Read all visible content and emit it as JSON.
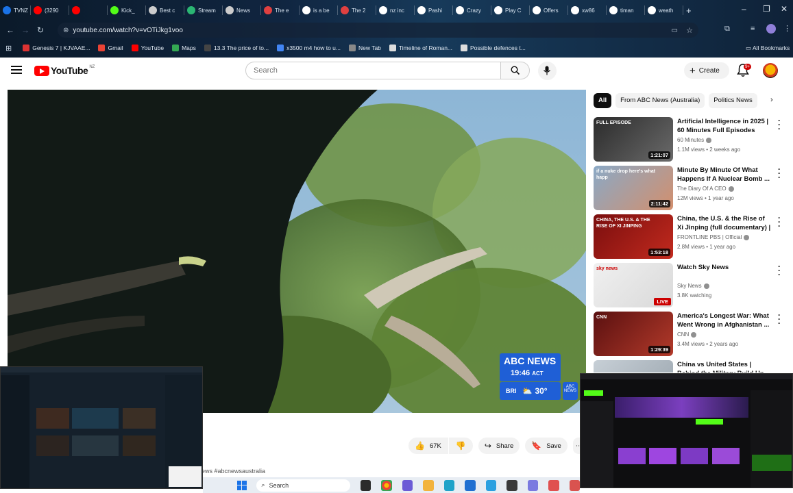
{
  "browser": {
    "tabs": [
      {
        "label": "TVNZ",
        "color": "#1a73e8"
      },
      {
        "label": "(3290",
        "color": "#ff0000"
      },
      {
        "label": "",
        "color": "#ff0000"
      },
      {
        "label": "Kick_",
        "color": "#53fc18"
      },
      {
        "label": "Best c",
        "color": "#cccccc"
      },
      {
        "label": "Stream",
        "color": "#2bb673"
      },
      {
        "label": "News",
        "color": "#cccccc"
      },
      {
        "label": "The e",
        "color": "#e04040"
      },
      {
        "label": "is a be",
        "color": "#ffffff"
      },
      {
        "label": "The 2",
        "color": "#e04040"
      },
      {
        "label": "nz inc",
        "color": "#ffffff"
      },
      {
        "label": "Pashi",
        "color": "#ffffff"
      },
      {
        "label": "Crazy",
        "color": "#ffffff"
      },
      {
        "label": "Play C",
        "color": "#ffffff"
      },
      {
        "label": "Offers",
        "color": "#ffffff"
      },
      {
        "label": "xw86",
        "color": "#ffffff"
      },
      {
        "label": "timan",
        "color": "#ffffff"
      },
      {
        "label": "weath",
        "color": "#ffffff"
      }
    ],
    "new_tab": "+",
    "window_controls": {
      "minimize": "–",
      "maximize": "❐",
      "close": "✕"
    },
    "url": "youtube.com/watch?v=vOTiJkg1voo",
    "bookmarks": [
      {
        "label": "Genesis 7 | KJVAAE...",
        "color": "#d33"
      },
      {
        "label": "Gmail",
        "color": "#ea4335"
      },
      {
        "label": "YouTube",
        "color": "#ff0000"
      },
      {
        "label": "Maps",
        "color": "#34a853"
      },
      {
        "label": "13.3 The price of to...",
        "color": "#444"
      },
      {
        "label": "x3500 m4 how to u...",
        "color": "#4285f4"
      },
      {
        "label": "New Tab",
        "color": "#888"
      },
      {
        "label": "Timeline of Roman...",
        "color": "#ddd"
      },
      {
        "label": "Possible defences t...",
        "color": "#ddd"
      }
    ],
    "all_bookmarks": "All Bookmarks"
  },
  "youtube": {
    "logo_word": "YouTube",
    "region": "NZ",
    "search_placeholder": "Search",
    "create_label": "Create",
    "notif_badge": "9+",
    "chips": [
      "All",
      "From ABC News (Australia)",
      "Politics News"
    ],
    "recommendations": [
      {
        "title": "Artificial Intelligence in 2025 | 60 Minutes Full Episodes",
        "channel": "60 Minutes",
        "meta": "1.1M views • 2 weeks ago",
        "duration": "1:21:07",
        "thumb_colors": [
          "#2b2b2b",
          "#6a6a6a"
        ],
        "thumb_label": "FULL EPISODE"
      },
      {
        "title": "Minute By Minute Of What Happens If A Nuclear Bomb ...",
        "channel": "The Diary Of A CEO",
        "meta": "12M views • 1 year ago",
        "duration": "2:11:42",
        "thumb_colors": [
          "#8aa9c6",
          "#d38f6d"
        ],
        "thumb_label": "if a nuke drop here's what happ"
      },
      {
        "title": "China, the U.S. & the Rise of Xi Jinping (full documentary) | ...",
        "channel": "FRONTLINE PBS | Official",
        "meta": "2.8M views • 1 year ago",
        "duration": "1:53:18",
        "thumb_colors": [
          "#7a0e0e",
          "#c22a1e"
        ],
        "thumb_label": "CHINA, THE U.S. & THE RISE OF XI JINPING"
      },
      {
        "title": "Watch Sky News",
        "channel": "Sky News",
        "meta": "3.8K watching",
        "duration": "LIVE",
        "thumb_colors": [
          "#f0f0f0",
          "#d9d9d9"
        ],
        "thumb_label": "sky news"
      },
      {
        "title": "America's Longest War: What Went Wrong in Afghanistan ...",
        "channel": "CNN",
        "meta": "3.4M views • 2 years ago",
        "duration": "1:29:39",
        "thumb_colors": [
          "#5a1010",
          "#b33a2a"
        ],
        "thumb_label": "CNN"
      },
      {
        "title": "China vs United States | Behind the Military Build Up",
        "channel": "",
        "meta": "",
        "duration": "",
        "thumb_colors": [
          "#c7cfd6",
          "#9aa5ae"
        ],
        "thumb_label": ""
      }
    ],
    "player_overlay": {
      "brand": "ABC NEWS",
      "time": "19:46",
      "tz": "ACT",
      "city": "BRI",
      "temp": "30°",
      "mini": "ABC NEWS"
    },
    "actions": {
      "likes": "67K",
      "share": "Share",
      "save": "Save",
      "more": "⋯"
    },
    "hashtag_fragment": "ews #abcnewsaustralia"
  },
  "taskbar": {
    "search": "Search"
  },
  "icons": [
    "menu-icon",
    "search-icon",
    "mic-icon",
    "bell-icon",
    "like-icon",
    "dislike-icon",
    "share-icon",
    "save-icon",
    "more-icon",
    "chevron-right-icon"
  ]
}
